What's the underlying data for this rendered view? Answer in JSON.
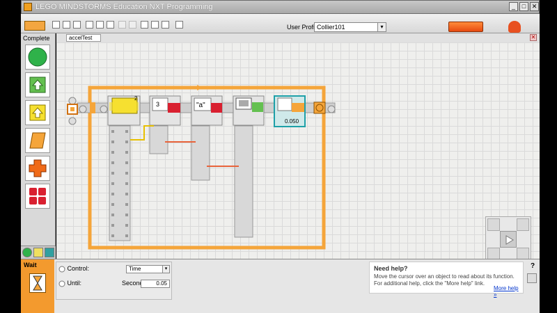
{
  "window": {
    "title": "LEGO MINDSTORMS Education NXT Programming",
    "minimize": "_",
    "maximize": "□",
    "close": "✕"
  },
  "toolbar": {
    "user_profile_label": "User Profile:",
    "user_profile_value": "Collier101",
    "dropdown_glyph": "▾"
  },
  "palette": {
    "title": "Complete",
    "blocks": [
      "common-move",
      "record-play",
      "sound",
      "display",
      "wait",
      "loop-switch"
    ]
  },
  "program": {
    "tab_label": "accelTest",
    "close_glyph": "✕",
    "loop_count_label": "2",
    "text_block_value": "\"a\"",
    "number_block_value": "3",
    "wait_value": "0.050"
  },
  "bottom": {
    "block_title": "Wait",
    "control_label": "Control:",
    "control_value": "Time",
    "until_label": "Until:",
    "seconds_label": "Seconds:",
    "seconds_value": "0.05",
    "help_title": "Need help?",
    "help_text": "Move the cursor over an object to read about its function. For additional help, click the \"More help\" link.",
    "help_link": "More help »",
    "question_mark": "?"
  },
  "colors": {
    "loop_orange": "#f5a53a",
    "wire_orange": "#e8633a",
    "wire_yellow": "#e8c000",
    "accent_red": "#d92030"
  }
}
